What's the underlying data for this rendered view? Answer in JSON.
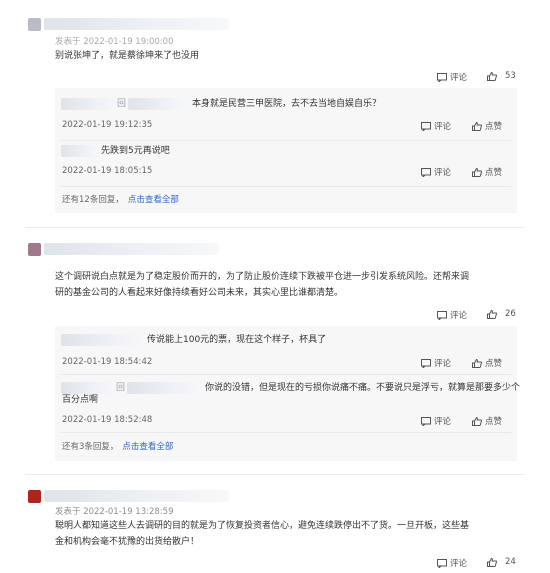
{
  "actions": {
    "comment": "评论",
    "like": "点赞"
  },
  "comments": [
    {
      "author_visible": "发表于 2022-01-19 19:00:00",
      "text": "别说张坤了，就是蔡徐坤来了也没用",
      "likes": "53",
      "replies": [
        {
          "prefix": "回",
          "text": "本身就是民营三甲医院，去不去当地自娱自乐？",
          "time": "2022-01-19 19:12:35"
        },
        {
          "prefix": "",
          "text": "先跌到5元再说吧",
          "time": "2022-01-19 18:05:15"
        }
      ],
      "more_count": "还有12条回复，",
      "more_link": "点击查看全部"
    },
    {
      "text_line1": "这个调研说白点就是为了稳定股价而开的，为了防止股价连续下跌被平仓进一步引发系统风险。还帮来调",
      "text_line2": "研的基金公司的人看起来好像持续看好公司未来，其实心里比谁都清楚。",
      "likes": "26",
      "replies": [
        {
          "prefix": "",
          "text": "传说能上100元的票，现在这个样子，杯具了",
          "time": "2022-01-19 18:54:42"
        },
        {
          "prefix": "回",
          "text_line1": "你说的没错，但是现在的亏损你说痛不痛。不要说只是浮亏，就算是那要多少个",
          "text_line2": "百分点啊",
          "time": "2022-01-19 18:52:48"
        }
      ],
      "more_count": "还有3条回复，",
      "more_link": "点击查看全部"
    },
    {
      "author_visible": "发表于 2022-01-19 13:28:59",
      "text_line1": "聪明人都知道这些人去调研的目的就是为了恢复投资者信心，避免连续跌停出不了货。一旦开板，这些基",
      "text_line2": "金和机构会毫不犹豫的出货给散户！",
      "likes": "24"
    }
  ]
}
